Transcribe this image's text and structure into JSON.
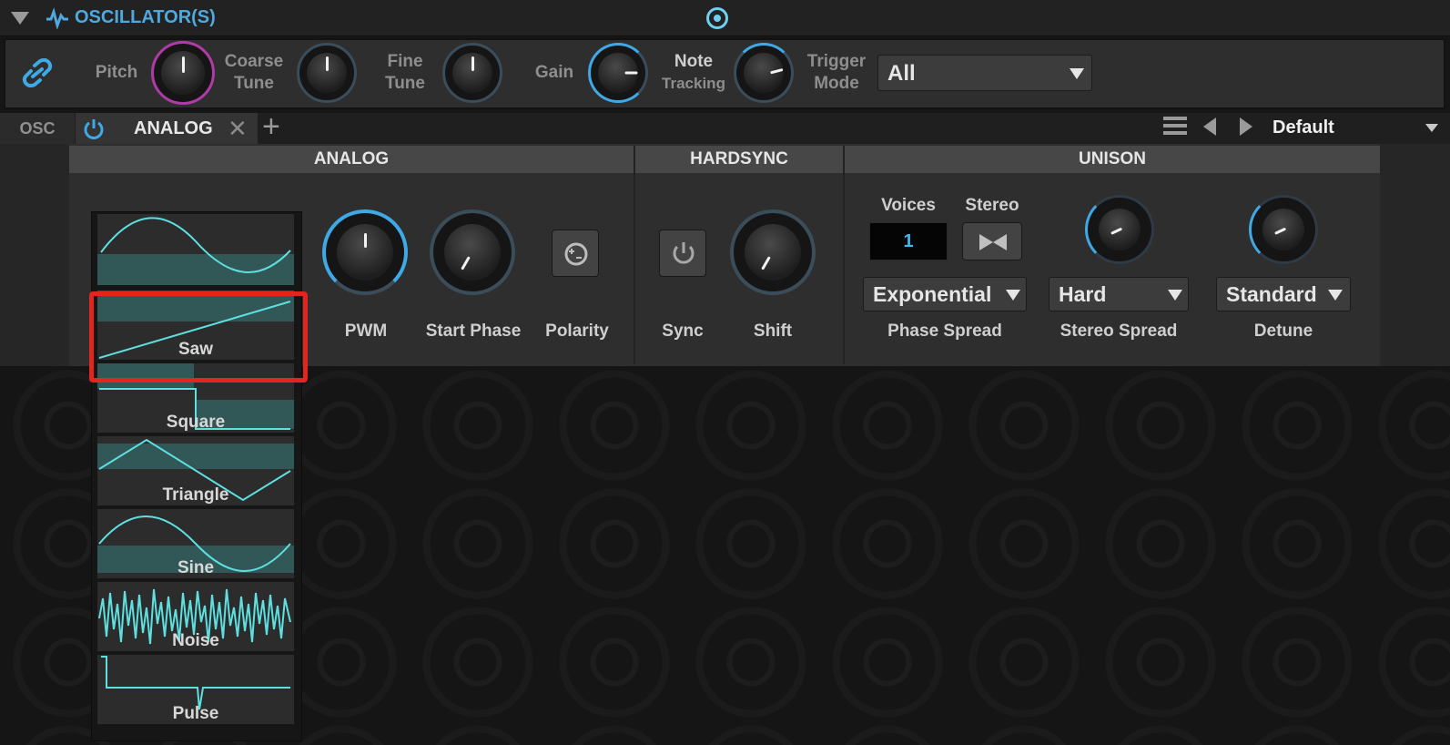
{
  "header": {
    "title": "OSCILLATOR(S)",
    "collapse_icon": "triangle-down-icon",
    "waveform_icon": "pulse-icon",
    "target_icon": "target-icon",
    "title_color": "#4fa9df"
  },
  "main_controls": {
    "pitch_label": "Pitch",
    "coarse_tune_label": [
      "Coarse",
      "Tune"
    ],
    "fine_tune_label": [
      "Fine",
      "Tune"
    ],
    "gain_label": "Gain",
    "note_tracking_label": [
      "Note",
      "Tracking"
    ],
    "trigger_mode_label": [
      "Trigger",
      "Mode"
    ],
    "trigger_mode_value": "All",
    "link_icon": "link-icon",
    "accent_color": "#3fa9e6",
    "pitch_ring_color": "#b03aa8"
  },
  "tabs": {
    "osc_label": "OSC",
    "active_tab": "ANALOG",
    "close_icon": "close-icon",
    "add_icon": "plus-icon",
    "power_icon": "power-icon",
    "menu_icon": "hamburger-icon",
    "prev_icon": "arrow-left-icon",
    "next_icon": "arrow-right-icon",
    "preset": "Default"
  },
  "sections": {
    "analog": "ANALOG",
    "hardsync": "HARDSYNC",
    "unison": "UNISON"
  },
  "analog": {
    "pwm_label": "PWM",
    "start_phase_label": "Start Phase",
    "polarity_label": "Polarity"
  },
  "hardsync": {
    "sync_label": "Sync",
    "shift_label": "Shift"
  },
  "unison": {
    "voices_label": "Voices",
    "voices_value": "1",
    "stereo_label": "Stereo",
    "phase_spread_value": "Exponential",
    "phase_spread_label": "Phase Spread",
    "stereo_spread_value": "Hard",
    "stereo_spread_label": "Stereo Spread",
    "detune_value": "Standard",
    "detune_label": "Detune"
  },
  "waveforms": [
    "Saw",
    "Square",
    "Triangle",
    "Sine",
    "Noise",
    "Pulse"
  ],
  "highlight_color": "#e3241f",
  "wave_color": "#5ee0e0"
}
